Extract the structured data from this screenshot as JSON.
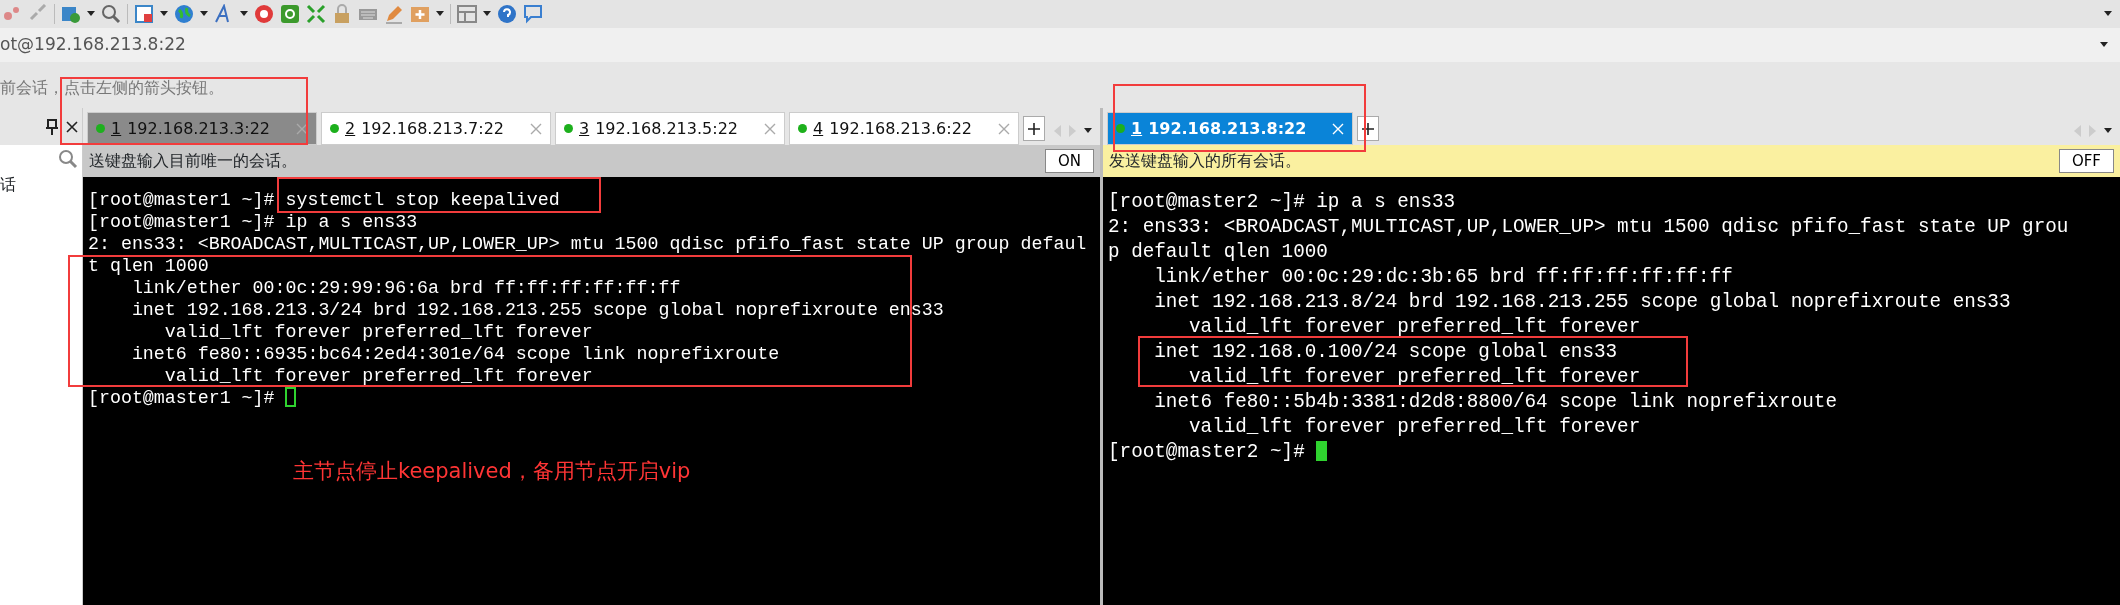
{
  "address_bar": {
    "value": "ot@192.168.213.8:22"
  },
  "hint": "前会话，点击左侧的箭头按钮。",
  "sidebar": {
    "items": [
      "话"
    ]
  },
  "panes": [
    {
      "active": false,
      "tabs": [
        {
          "number": "1",
          "label": "192.168.213.3:22",
          "selected": true
        },
        {
          "number": "2",
          "label": "192.168.213.7:22",
          "selected": false
        },
        {
          "number": "3",
          "label": "192.168.213.5:22",
          "selected": false
        },
        {
          "number": "4",
          "label": "192.168.213.6:22",
          "selected": false
        }
      ],
      "banner": {
        "text": "送键盘输入目前唯一的会话。",
        "toggle": "ON"
      },
      "terminal": {
        "focused": false,
        "lines": [
          {
            "prompt": "[root@master1 ~]#",
            "command": "systemctl stop keepalived"
          },
          {
            "prompt": "[root@master1 ~]#",
            "command": "ip a s ens33"
          },
          "2: ens33: <BROADCAST,MULTICAST,UP,LOWER_UP> mtu 1500 qdisc pfifo_fast state UP group defaul",
          "t qlen 1000",
          "    link/ether 00:0c:29:99:96:6a brd ff:ff:ff:ff:ff:ff",
          "    inet 192.168.213.3/24 brd 192.168.213.255 scope global noprefixroute ens33",
          "       valid_lft forever preferred_lft forever",
          "    inet6 fe80::6935:bc64:2ed4:301e/64 scope link noprefixroute",
          "       valid_lft forever preferred_lft forever",
          {
            "prompt": "[root@master1 ~]#"
          }
        ],
        "note": "主节点停止keepalived，备用节点开启vip"
      }
    },
    {
      "active": true,
      "tabs": [
        {
          "number": "1",
          "label": "192.168.213.8:22",
          "selected": true
        }
      ],
      "banner": {
        "text": "发送键盘输入的所有会话。",
        "toggle": "OFF"
      },
      "terminal": {
        "focused": true,
        "lines": [
          {
            "prompt": "[root@master2 ~]#",
            "command": "ip a s ens33"
          },
          "2: ens33: <BROADCAST,MULTICAST,UP,LOWER_UP> mtu 1500 qdisc pfifo_fast state UP grou",
          "p default qlen 1000",
          "    link/ether 00:0c:29:dc:3b:65 brd ff:ff:ff:ff:ff:ff",
          "    inet 192.168.213.8/24 brd 192.168.213.255 scope global noprefixroute ens33",
          "       valid_lft forever preferred_lft forever",
          "    inet 192.168.0.100/24 scope global ens33",
          "       valid_lft forever preferred_lft forever",
          "    inet6 fe80::5b4b:3381:d2d8:8800/64 scope link noprefixroute",
          "       valid_lft forever preferred_lft forever",
          {
            "prompt": "[root@master2 ~]#"
          }
        ]
      }
    }
  ]
}
